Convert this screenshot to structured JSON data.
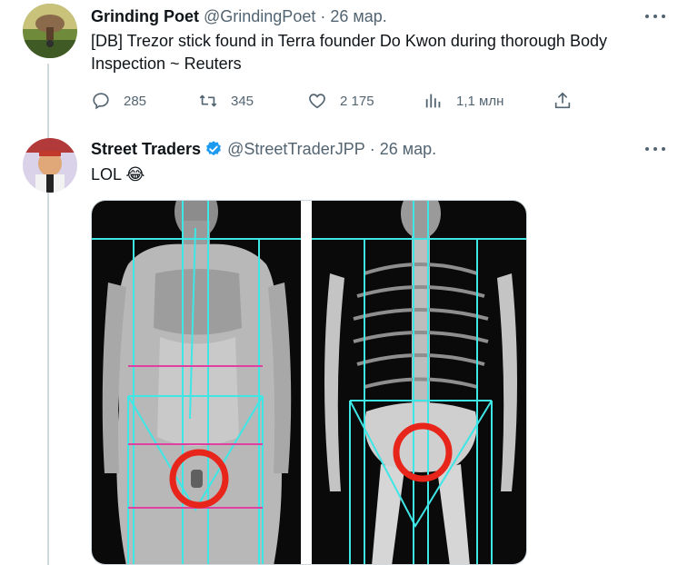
{
  "tweets": [
    {
      "author_name": "Grinding Poet",
      "handle": "@GrindingPoet",
      "separator": "·",
      "date": "26 мар.",
      "text": "[DB] Trezor stick found in Terra founder Do Kwon during thorough Body Inspection ~ Reuters",
      "actions": {
        "replies": "285",
        "retweets": "345",
        "likes": "2 175",
        "views": "1,1 млн"
      }
    },
    {
      "author_name": "Street Traders",
      "handle": "@StreetTraderJPP",
      "separator": "·",
      "date": "26 мар.",
      "text": "LOL 😂",
      "verified": true
    }
  ],
  "icons": {
    "reply": "reply-icon",
    "retweet": "retweet-icon",
    "like": "heart-icon",
    "views": "views-icon",
    "share": "share-icon",
    "more": "more-icon",
    "verified": "verified-badge-icon"
  },
  "colors": {
    "text": "#0f1419",
    "secondary": "#536471",
    "verified": "#1d9bf0",
    "thread_line": "#cfd9de",
    "overlay_cyan": "#3ee6e6",
    "overlay_magenta": "#e040a0",
    "highlight_red": "#e8251a"
  }
}
